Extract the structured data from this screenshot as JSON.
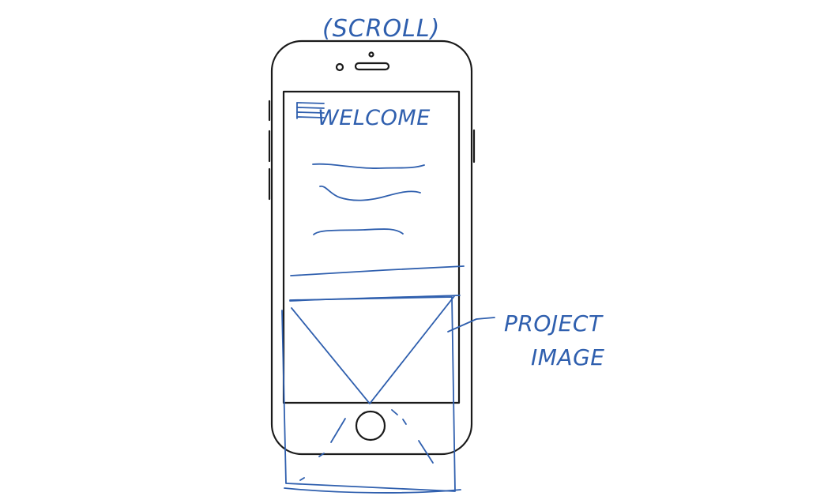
{
  "annotations": {
    "scroll_label": "(SCROLL)",
    "project_label_line1": "PROJECT",
    "project_label_line2": "IMAGE"
  },
  "screen": {
    "title": "WELCOME",
    "menu_icon": "hamburger-menu-icon",
    "image_placeholder_icon": "image-placeholder-icon"
  },
  "colors": {
    "device_outline": "#1a1a1a",
    "pen_ink": "#2f5fae",
    "background": "#ffffff"
  }
}
